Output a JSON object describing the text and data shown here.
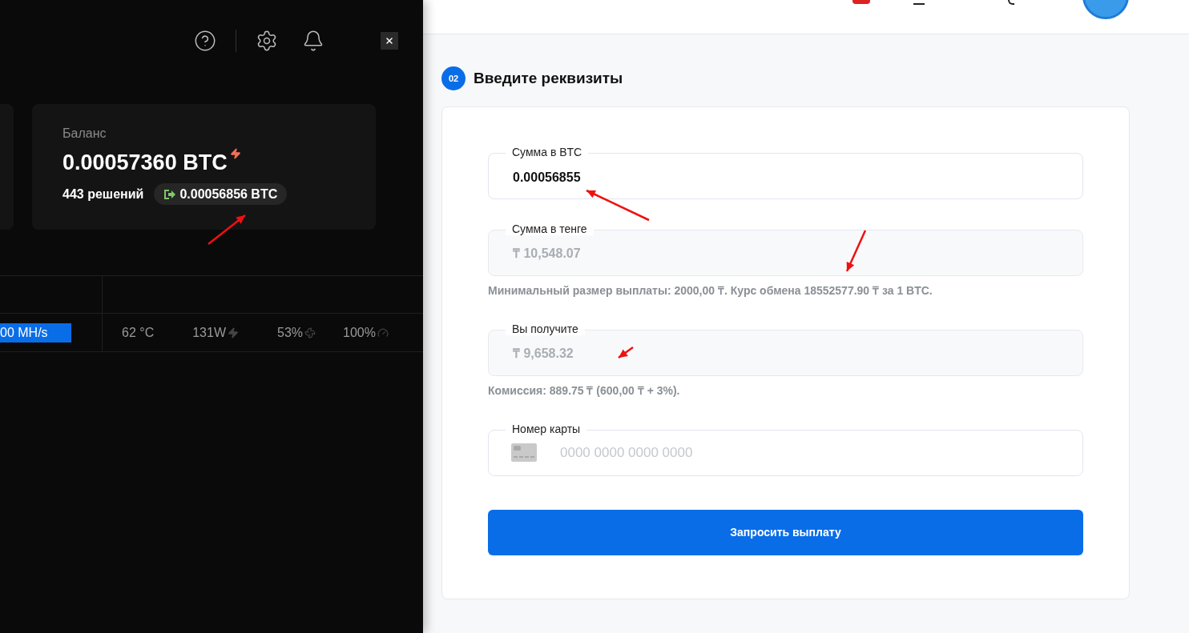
{
  "panel": {
    "balance_label": "Баланс",
    "balance": "0.00057360 BTC",
    "solutions": "443 решений",
    "payout": "0.00056856 BTC",
    "gpu_row": {
      "hashrate": "00 MH/s",
      "temperature": "62 °C",
      "power": "131W",
      "fan": "53%",
      "load": "100%"
    }
  },
  "step": {
    "number": "02",
    "title": "Введите реквизиты"
  },
  "fields": [
    {
      "kind": "input",
      "label": "Сумма в BTC",
      "value": "0.00056855"
    },
    {
      "kind": "readonly",
      "label": "Сумма в тенге",
      "value": "₸ 10,548.07",
      "hint": "Минимальный размер выплаты: 2000,00 ₸. Курс обмена 18552577.90 ₸ за 1 BTC."
    },
    {
      "kind": "readonly",
      "label": "Вы получите",
      "value": "₸ 9,658.32",
      "hint": "Комиссия: 889.75 ₸ (600,00 ₸ + 3%)."
    },
    {
      "kind": "card",
      "label": "Номер карты",
      "placeholder": "0000 0000 0000 0000"
    }
  ],
  "submit": "Запросить выплату"
}
